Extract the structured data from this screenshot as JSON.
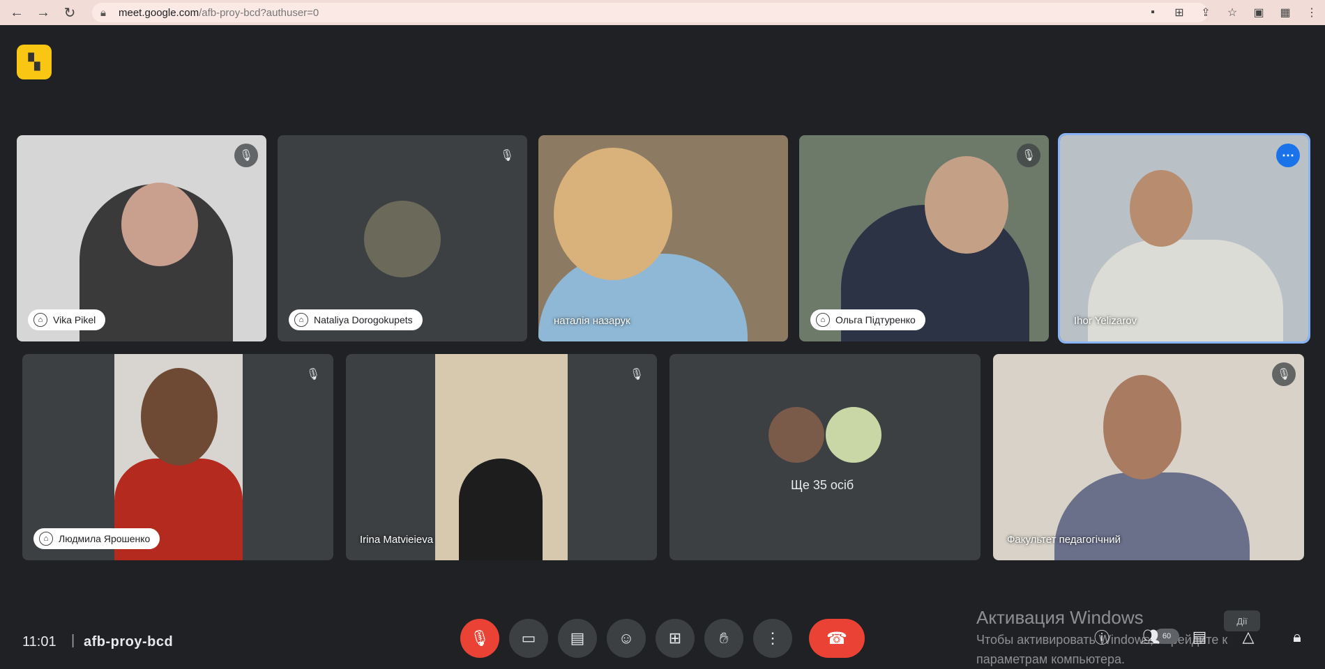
{
  "browser": {
    "url_host": "meet.google.com",
    "url_path": "/afb-proy-bcd?authuser=0"
  },
  "participants": [
    {
      "name": "Vika Pikel"
    },
    {
      "name": "Nataliya Dorogokupets"
    },
    {
      "name": "наталія назарук"
    },
    {
      "name": "Ольга Підтуренко"
    },
    {
      "name": "Ihor Yelizarov"
    },
    {
      "name": "Людмила Ярошенко"
    },
    {
      "name": "Irina Matvieieva"
    },
    {
      "name": "Факультет педагогічний"
    }
  ],
  "others": {
    "label": "Ще 35 осіб"
  },
  "meeting": {
    "time": "11:01",
    "separator": "|",
    "code": "afb-proy-bcd"
  },
  "watermark": {
    "title": "Активация Windows",
    "line1": "Чтобы активировать Windows, перейдите к",
    "line2": "параметрам компьютера."
  },
  "badges": {
    "count": "60",
    "tooltip": "Дії"
  },
  "icons": {
    "mic_off": "mic-off-icon",
    "camera": "camera-icon",
    "captions": "captions-icon",
    "emoji": "emoji-icon",
    "present": "present-icon",
    "hand": "raise-hand-icon",
    "more": "more-vert-icon",
    "end": "end-call-icon",
    "info": "info-icon",
    "people": "people-icon",
    "chat": "chat-icon",
    "activities": "activities-icon",
    "lock": "host-controls-icon"
  },
  "colors": {
    "accent": "#1a73e8",
    "danger": "#ea4335",
    "background": "#202124",
    "tile": "#3c4043"
  }
}
